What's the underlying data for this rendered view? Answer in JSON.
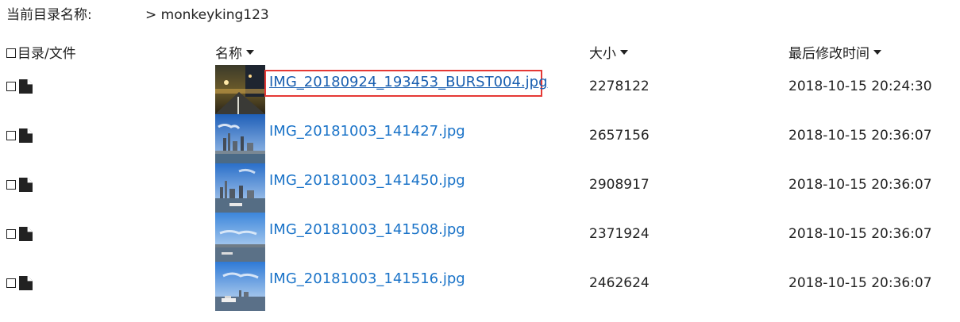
{
  "breadcrumb": {
    "label": "当前目录名称:",
    "path": "> monkeyking123"
  },
  "columns": {
    "checkbox": "目录/文件",
    "name": "名称",
    "size": "大小",
    "time": "最后修改时间"
  },
  "files": [
    {
      "name": "IMG_20180924_193453_BURST004.jpg",
      "size": "2278122",
      "modified": "2018-10-15 20:24:30",
      "thumbnail": "night-street"
    },
    {
      "name": "IMG_20181003_141427.jpg",
      "size": "2657156",
      "modified": "2018-10-15 20:36:07",
      "thumbnail": "city-skyline"
    },
    {
      "name": "IMG_20181003_141450.jpg",
      "size": "2908917",
      "modified": "2018-10-15 20:36:07",
      "thumbnail": "city-river"
    },
    {
      "name": "IMG_20181003_141508.jpg",
      "size": "2371924",
      "modified": "2018-10-15 20:36:07",
      "thumbnail": "sky-river"
    },
    {
      "name": "IMG_20181003_141516.jpg",
      "size": "2462624",
      "modified": "2018-10-15 20:36:07",
      "thumbnail": "sky-boat"
    }
  ],
  "selected_index": 0,
  "colors": {
    "link": "#1a73c8",
    "selection_border": "#e53935"
  }
}
